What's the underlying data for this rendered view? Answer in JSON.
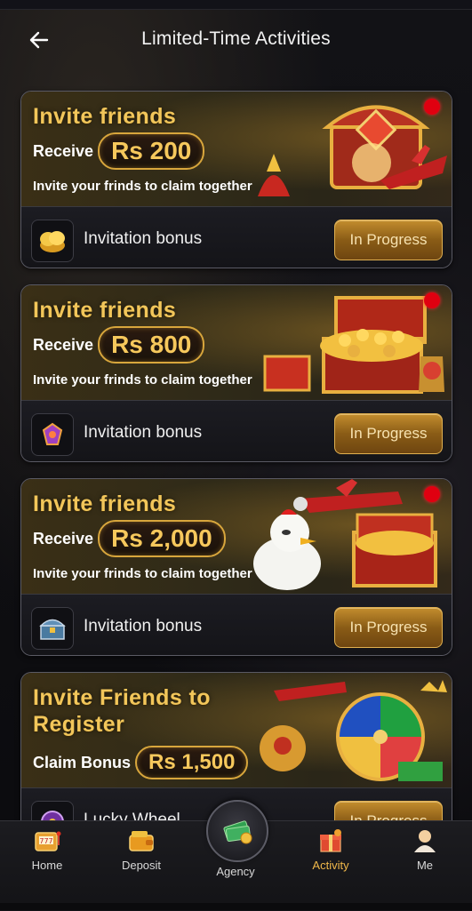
{
  "header": {
    "title": "Limited-Time Activities",
    "back_icon": "arrow-left-icon"
  },
  "cards": [
    {
      "title": "Invite friends",
      "receive_label": "Receive",
      "amount": "Rs 200",
      "description": "Invite your frinds to claim together",
      "bonus_label": "Invitation bonus",
      "button_label": "In Progress",
      "art": "treasure-chest-jester-plane",
      "icon": "gold-coins-icon"
    },
    {
      "title": "Invite friends",
      "receive_label": "Receive",
      "amount": "Rs 800",
      "description": "Invite your frinds to claim together",
      "bonus_label": "Invitation bonus",
      "button_label": "In Progress",
      "art": "open-chest-gold-coins-idol",
      "icon": "purple-gem-icon"
    },
    {
      "title": "Invite friends",
      "receive_label": "Receive",
      "amount": "Rs 2,000",
      "description": "Invite your frinds to claim together",
      "bonus_label": "Invitation bonus",
      "button_label": "In Progress",
      "art": "chicken-plane-chest",
      "icon": "treasure-chest-icon"
    },
    {
      "title_line1": "Invite Friends to",
      "title_line2": "Register",
      "receive_label": "Claim Bonus",
      "amount": "Rs 1,500",
      "bonus_label": "Lucky Wheel",
      "button_label": "In Progress",
      "art": "lucky-wheel-plane-idol-cash",
      "icon": "lucky-wheel-icon"
    }
  ],
  "nav": {
    "items": [
      {
        "label": "Home",
        "icon": "slot-machine-icon"
      },
      {
        "label": "Deposit",
        "icon": "wallet-icon"
      },
      {
        "label": "Agency",
        "icon": "cash-stack-icon"
      },
      {
        "label": "Activity",
        "icon": "gift-icon"
      },
      {
        "label": "Me",
        "icon": "user-avatar-icon"
      }
    ],
    "active": "Activity"
  },
  "colors": {
    "accent_gold": "#f2c65a",
    "button_gold": "#c38d2e",
    "badge_red": "#e00010",
    "active_nav": "#f0b84a"
  }
}
